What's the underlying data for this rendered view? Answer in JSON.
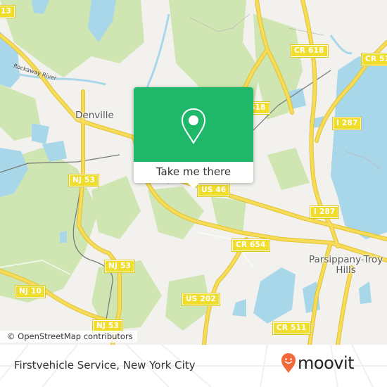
{
  "map": {
    "place_labels": {
      "denville": "Denville",
      "parsippany_line1": "Parsippany-Troy",
      "parsippany_line2": "Hills"
    },
    "river_label": "Rockaway River",
    "route_shields": {
      "cr513": "13",
      "cr618_top": "CR 618",
      "cr618_mid": "618",
      "cr511_top": "CR 51",
      "i287_top": "I 287",
      "i287_mid": "I 287",
      "nj53_a": "NJ 53",
      "nj53_b": "NJ 53",
      "nj53_c": "NJ 53",
      "nj10": "NJ 10",
      "us46": "US 46",
      "cr654": "CR 654",
      "us202": "US 202",
      "cr511_bottom": "CR 511"
    },
    "attribution": "© OpenStreetMap contributors",
    "colors": {
      "land": "#f2f1ee",
      "forest": "#cfe6b2",
      "water": "#a9d7ea",
      "road": "#f5d94a",
      "shield": "#f1dd2b"
    }
  },
  "popup": {
    "icon": "location-pin-icon",
    "button_label": "Take me there",
    "color": "#1fb86a"
  },
  "footer": {
    "place_name": "Firstvehicle Service, New York City",
    "brand": "moovit",
    "brand_icon": "moovit-smile-pin-icon",
    "brand_color": "#f26a3a"
  }
}
